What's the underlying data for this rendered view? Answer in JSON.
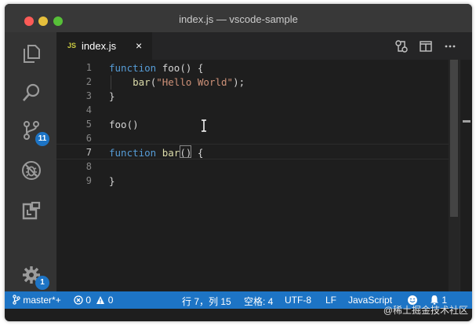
{
  "window": {
    "title": "index.js — vscode-sample"
  },
  "activity_bar": {
    "items": [
      {
        "name": "explorer",
        "icon": "files-icon"
      },
      {
        "name": "search",
        "icon": "search-icon"
      },
      {
        "name": "source-control",
        "icon": "source-control-icon",
        "badge": "11"
      },
      {
        "name": "debug",
        "icon": "no-bug-icon"
      },
      {
        "name": "extensions",
        "icon": "extensions-icon"
      }
    ],
    "manage": {
      "icon": "gear-icon",
      "badge": "1"
    }
  },
  "tabs": [
    {
      "icon_text": "JS",
      "label": "index.js",
      "close": "×",
      "active": true
    }
  ],
  "editor": {
    "line_numbers": [
      "1",
      "2",
      "3",
      "4",
      "5",
      "6",
      "7",
      "8",
      "9"
    ],
    "active_line": 7,
    "lines": {
      "l1_kw": "function",
      "l1_rest": " foo() {",
      "l2_fn": "bar",
      "l2_open": "(",
      "l2_str": "\"Hello World\"",
      "l2_close": ");",
      "l3": "}",
      "l5": "foo()",
      "l7_kw": "function",
      "l7_fn": " bar",
      "l7_paren": "()",
      "l7_brace": " {",
      "l9": "}"
    }
  },
  "status_bar": {
    "branch": "master*+",
    "errors": "0",
    "warnings": "0",
    "position": "行 7，列 15",
    "spaces": "空格: 4",
    "encoding": "UTF-8",
    "eol": "LF",
    "language": "JavaScript",
    "notifications": "1"
  },
  "watermark": "@稀土掘金技术社区",
  "colors": {
    "accent": "#1d74c5",
    "editor_bg": "#1e1e1e",
    "keyword": "#569cd6",
    "string": "#ce9178",
    "function": "#dcdcaa"
  }
}
